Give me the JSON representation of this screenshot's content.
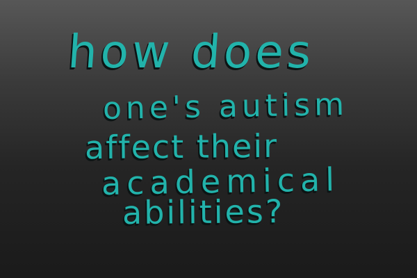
{
  "lines": [
    "how does",
    "one's autism",
    "affect their",
    "academical",
    "abilities?"
  ],
  "colors": {
    "text": "#22b3ab",
    "shadow": "#0c1414",
    "background_top": "#575757",
    "background_bottom": "#1a1a1a"
  }
}
